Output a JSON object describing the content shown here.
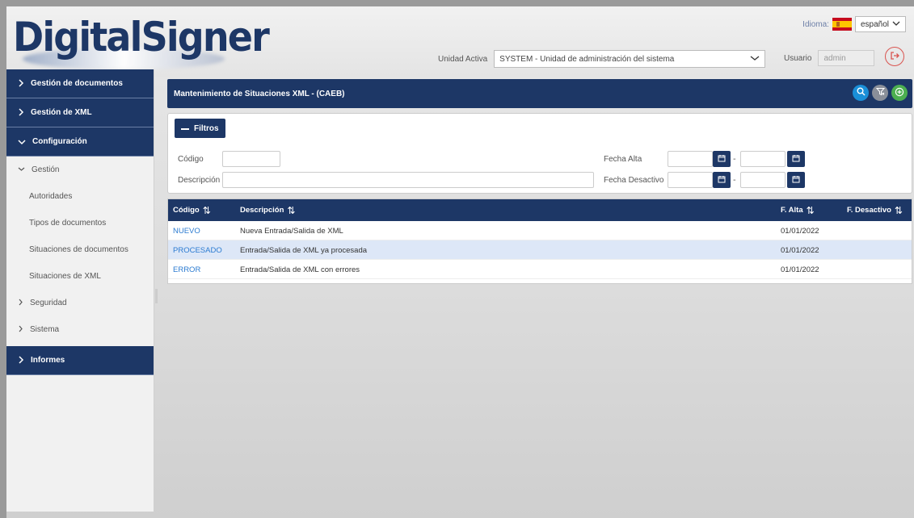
{
  "header": {
    "logo_text": "DigitalSigner",
    "idioma_label": "Idioma:",
    "language_value": "español",
    "unidad_label": "Unidad Activa",
    "unidad_value": "SYSTEM - Unidad de administración del sistema",
    "usuario_label": "Usuario",
    "usuario_value": "admin"
  },
  "sidebar": {
    "items": [
      {
        "label": "Gestión de documentos"
      },
      {
        "label": "Gestión de XML"
      },
      {
        "label": "Configuración"
      }
    ],
    "gestion_label": "Gestión",
    "gestion_items": [
      {
        "label": "Autoridades"
      },
      {
        "label": "Tipos de documentos"
      },
      {
        "label": "Situaciones de documentos"
      },
      {
        "label": "Situaciones de XML"
      }
    ],
    "seguridad_label": "Seguridad",
    "sistema_label": "Sistema",
    "informes_label": "Informes"
  },
  "main": {
    "title": "Mantenimiento de Situaciones XML - (CAEB)"
  },
  "filters": {
    "toggle_label": "Filtros",
    "codigo_label": "Código",
    "descripcion_label": "Descripción",
    "fecha_alta_label": "Fecha Alta",
    "fecha_desactivo_label": "Fecha Desactivo",
    "dash": "-"
  },
  "table": {
    "headers": [
      "Código",
      "Descripción",
      "F. Alta",
      "F. Desactivo"
    ],
    "rows": [
      {
        "codigo": "NUEVO",
        "descripcion": "Nueva Entrada/Salida de XML",
        "alta": "01/01/2022",
        "desactivo": ""
      },
      {
        "codigo": "PROCESADO",
        "descripcion": "Entrada/Salida de XML ya procesada",
        "alta": "01/01/2022",
        "desactivo": ""
      },
      {
        "codigo": "ERROR",
        "descripcion": "Entrada/Salida de XML con errores",
        "alta": "01/01/2022",
        "desactivo": ""
      }
    ],
    "selected_row": 1
  },
  "colors": {
    "primary": "#1d3766",
    "link": "#2b7bd1",
    "search": "#1a8fd8",
    "add": "#4caf50",
    "logout": "#d9534f",
    "selected_row": "#dde7f7"
  },
  "icons": {
    "menu_chevron": "chevron-right-icon",
    "open_chevron": "chevron-down-icon",
    "search": "search-icon",
    "clear_filter": "filter-clear-icon",
    "add": "add-circle-icon",
    "logout": "logout-icon",
    "calendar": "calendar-icon",
    "sort": "sort-icon"
  }
}
